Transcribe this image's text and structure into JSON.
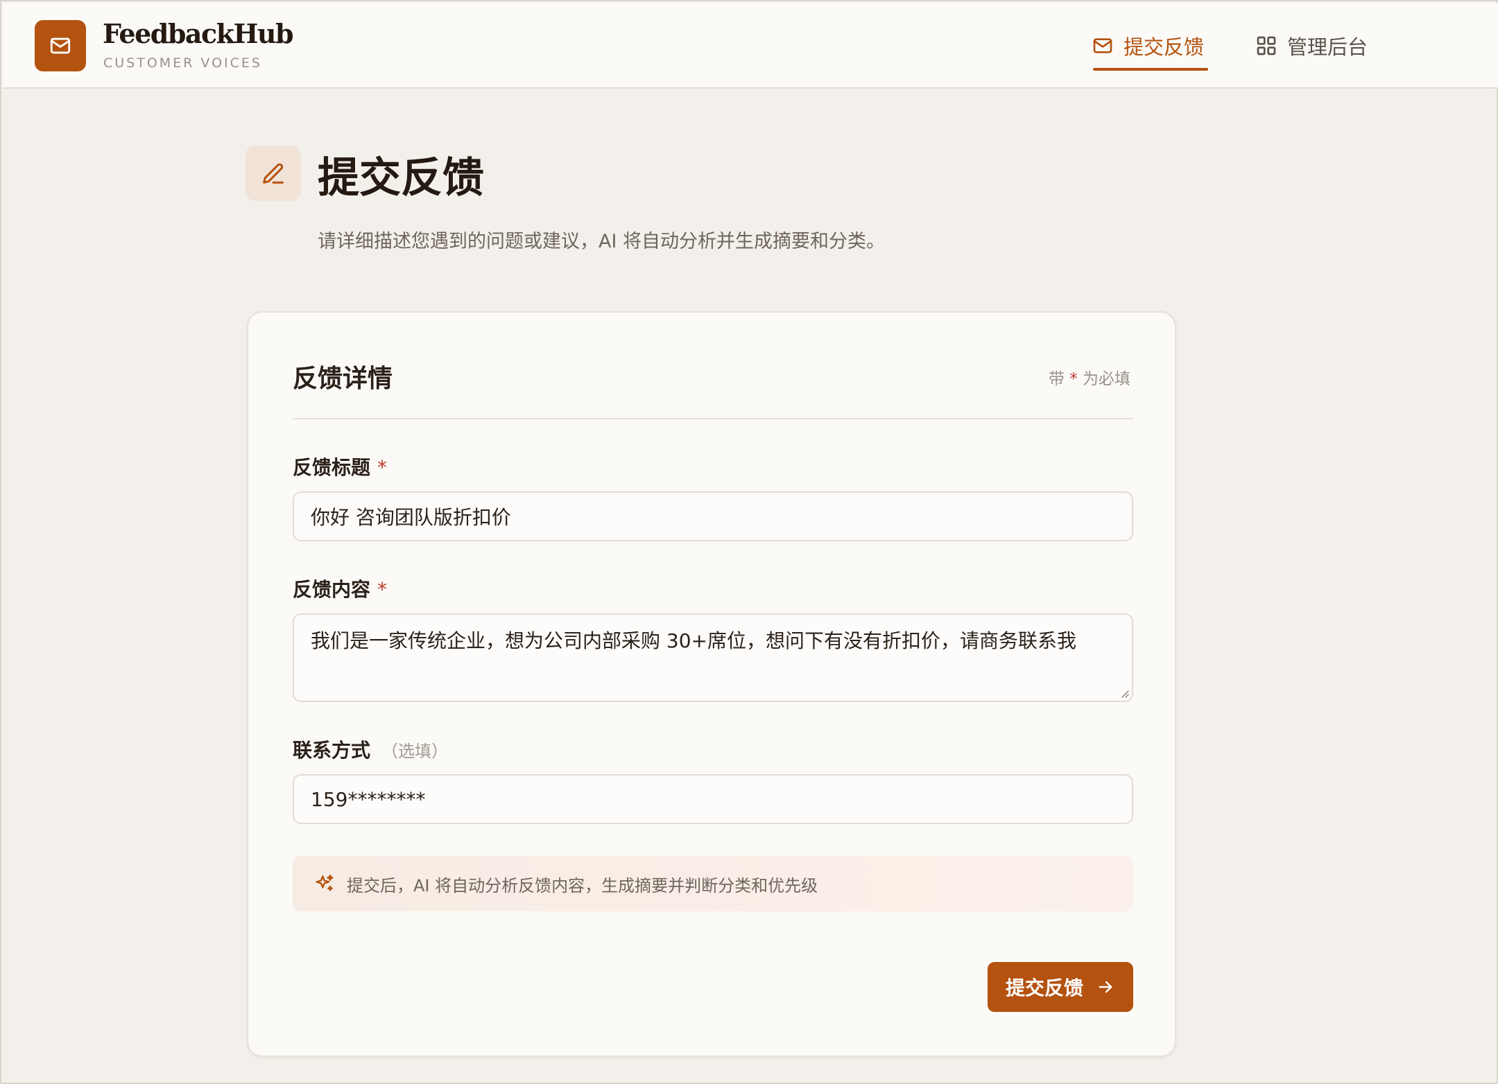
{
  "header": {
    "brand_name": "FeedbackHub",
    "brand_subtitle": "CUSTOMER VOICES",
    "nav": {
      "submit_label": "提交反馈",
      "admin_label": "管理后台"
    }
  },
  "page": {
    "title": "提交反馈",
    "description": "请详细描述您遇到的问题或建议，AI 将自动分析并生成摘要和分类。"
  },
  "form": {
    "card_title": "反馈详情",
    "required_note_prefix": "带",
    "required_star": "*",
    "required_note_suffix": "为必填",
    "title_field": {
      "label": "反馈标题",
      "value": "你好 咨询团队版折扣价"
    },
    "content_field": {
      "label": "反馈内容",
      "value": "我们是一家传统企业，想为公司内部采购 30+席位，想问下有没有折扣价，请商务联系我"
    },
    "contact_field": {
      "label": "联系方式",
      "optional": "（选填）",
      "value": "159********"
    },
    "ai_hint": "提交后，AI 将自动分析反馈内容，生成摘要并判断分类和优先级",
    "submit_label": "提交反馈"
  },
  "colors": {
    "accent": "#b4520f",
    "background": "#f3f0eb",
    "required": "#c0392b"
  },
  "icons": [
    "mail-icon",
    "grid-icon",
    "pencil-icon",
    "sparkle-icon",
    "arrow-right-icon"
  ]
}
